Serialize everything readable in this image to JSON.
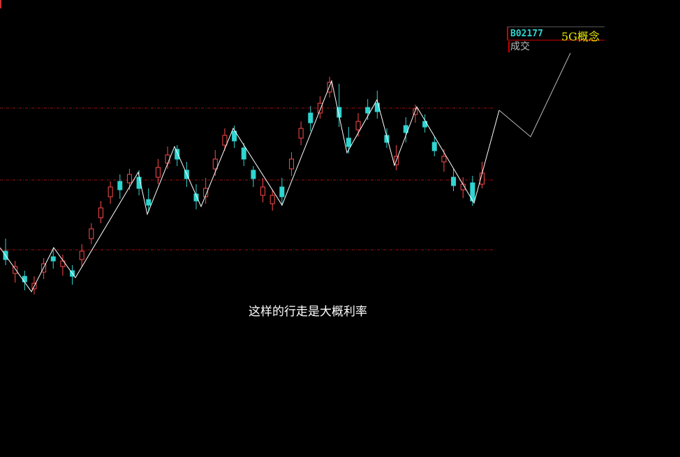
{
  "legend": {
    "code": "B02177",
    "name": "5G概念",
    "volume_label": "成交"
  },
  "caption": "这样的行走是大概利率",
  "colors": {
    "up": "#ff4a4a",
    "down": "#2fd5d0",
    "zigzag": "#ffffff",
    "projection": "#bbbbbb",
    "guide": "#a01010"
  },
  "chart_data": {
    "type": "candlestick",
    "title": "B02177 5G概念",
    "ylim": [
      0,
      500
    ],
    "guide_levels": [
      345,
      242,
      142
    ],
    "candles": [
      [
        140,
        128,
        158,
        120
      ],
      [
        108,
        118,
        126,
        95
      ],
      [
        104,
        96,
        112,
        84
      ],
      [
        86,
        94,
        104,
        78
      ],
      [
        110,
        122,
        130,
        100
      ],
      [
        132,
        126,
        145,
        115
      ],
      [
        118,
        126,
        135,
        105
      ],
      [
        112,
        104,
        120,
        92
      ],
      [
        128,
        140,
        150,
        118
      ],
      [
        158,
        172,
        180,
        150
      ],
      [
        188,
        202,
        212,
        180
      ],
      [
        218,
        232,
        240,
        208
      ],
      [
        240,
        228,
        250,
        215
      ],
      [
        238,
        250,
        258,
        228
      ],
      [
        246,
        230,
        256,
        220
      ],
      [
        214,
        206,
        230,
        196
      ],
      [
        246,
        260,
        272,
        236
      ],
      [
        266,
        278,
        290,
        258
      ],
      [
        286,
        272,
        292,
        262
      ],
      [
        256,
        244,
        268,
        232
      ],
      [
        222,
        212,
        236,
        200
      ],
      [
        218,
        230,
        245,
        208
      ],
      [
        258,
        272,
        285,
        248
      ],
      [
        292,
        306,
        316,
        284
      ],
      [
        312,
        298,
        320,
        288
      ],
      [
        288,
        272,
        295,
        262
      ],
      [
        256,
        244,
        262,
        232
      ],
      [
        220,
        232,
        245,
        210
      ],
      [
        208,
        220,
        228,
        198
      ],
      [
        232,
        218,
        245,
        205
      ],
      [
        258,
        272,
        282,
        248
      ],
      [
        302,
        316,
        326,
        292
      ],
      [
        338,
        324,
        348,
        312
      ],
      [
        338,
        352,
        362,
        330
      ],
      [
        368,
        382,
        390,
        360
      ],
      [
        346,
        332,
        380,
        318
      ],
      [
        302,
        290,
        318,
        280
      ],
      [
        314,
        326,
        338,
        304
      ],
      [
        346,
        338,
        358,
        328
      ],
      [
        352,
        340,
        370,
        330
      ],
      [
        306,
        296,
        316,
        288
      ],
      [
        264,
        276,
        292,
        256
      ],
      [
        320,
        310,
        332,
        296
      ],
      [
        336,
        344,
        350,
        324
      ],
      [
        326,
        318,
        336,
        310
      ],
      [
        296,
        284,
        304,
        276
      ],
      [
        268,
        276,
        286,
        254
      ],
      [
        246,
        234,
        258,
        226
      ],
      [
        228,
        236,
        246,
        216
      ],
      [
        238,
        212,
        248,
        205
      ],
      [
        236,
        252,
        268,
        230
      ]
    ],
    "zigzag": [
      145,
      82,
      145,
      102,
      253,
      193,
      290,
      204,
      316,
      206,
      384,
      281,
      357,
      263,
      347,
      209,
      342
    ],
    "projection": [
      342,
      304,
      424
    ]
  }
}
